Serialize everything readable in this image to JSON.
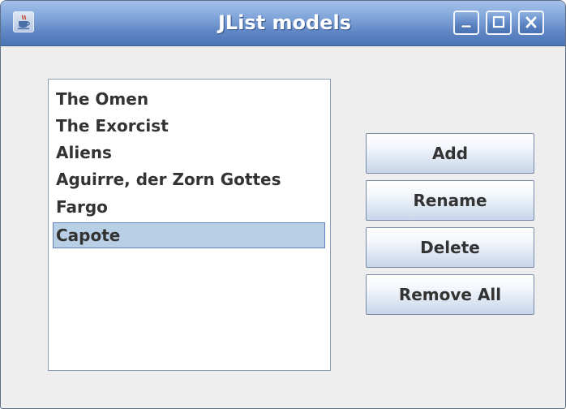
{
  "window": {
    "title": "JList models",
    "controls": [
      "minimize",
      "maximize",
      "close"
    ]
  },
  "list": {
    "items": [
      {
        "label": "The Omen",
        "selected": false
      },
      {
        "label": "The Exorcist",
        "selected": false
      },
      {
        "label": "Aliens",
        "selected": false
      },
      {
        "label": "Aguirre, der Zorn Gottes",
        "selected": false
      },
      {
        "label": "Fargo",
        "selected": false
      },
      {
        "label": "Capote",
        "selected": true
      }
    ]
  },
  "buttons": {
    "add": "Add",
    "rename": "Rename",
    "delete": "Delete",
    "remove_all": "Remove All"
  },
  "colors": {
    "titlebar": "#6f94cf",
    "selection": "#b8cfe5",
    "window_bg": "#eeeeee"
  },
  "icons": {
    "app": "java-coffee-cup-icon",
    "minimize": "minimize-icon",
    "maximize": "maximize-icon",
    "close": "close-icon"
  }
}
